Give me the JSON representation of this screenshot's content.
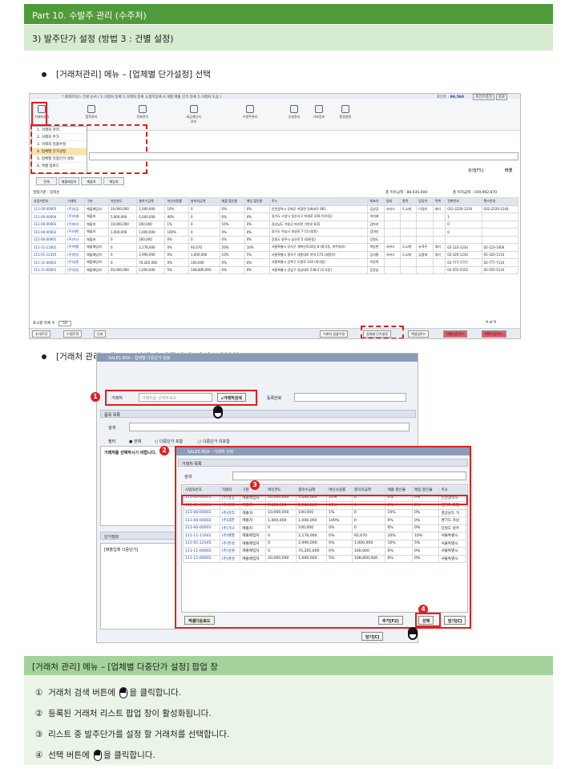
{
  "part_title": "Part 10. 수발주 관리 (수주처)",
  "section_title": "3) 발주단가 설정 (방법 3 : 건별 설정)",
  "bullet1": "[거래처관리] 메뉴 – [업체별 단가설정] 선택",
  "bullet2": "[거래처 관리] 메뉴 – [업체별 다중단가 설정] 팝업창",
  "shot1": {
    "top_text": "* 셀렉즈박스 간편 순서 ( 1.거래처 등록  2.거래처 등록  3.품목등록  4.개별 매출 인코 등록  5.거래처 도움 )",
    "point_label": "포인트 : ",
    "point_value": "99,560",
    "point_btn": "포인트충전",
    "exit_btn": "종료",
    "ribbon": [
      "거래처관리",
      "품목관리",
      "전표관리",
      "세금계산서관리",
      "수발주관리",
      "공생관리",
      "기초정보",
      "환경설정"
    ],
    "menu": [
      "1. 거래처 관리",
      "2. 거래처 추가",
      "3. 거래처 일괄수정",
      "4. 업체별 단가설정",
      "5. 업체별 다중단가 설정",
      "6. 엑셀 업로드"
    ],
    "tabs": [
      "전체",
      "매출매입처",
      "매출처",
      "매입처"
    ],
    "search_btn": "검색[F5]",
    "reset_btn": "리셋",
    "sort_label": "정렬기준 : 입력순",
    "sum1": "총 미수금액 : 88,035,000",
    "sum2": "총 미지급액 : 109,992,870",
    "columns": [
      "사업자번호",
      "거래처",
      "구분",
      "여신한도",
      "총미수금액",
      "여신사용률",
      "총미지급액",
      "매출 할인율",
      "매입 할인율",
      "주소",
      "대표자",
      "업태",
      "종목",
      "담당자",
      "직책",
      "전화번호",
      "팩스번호"
    ],
    "rows": [
      [
        "111-00-00005",
        "(주)성공",
        "매출매입처",
        "10,000,000",
        "1,000,000",
        "10%",
        "0",
        "0%",
        "0%",
        "인천광역시 강화군 하점면 강화대로 961",
        "김성공",
        "서비스",
        "도소매",
        "이경리",
        "대리",
        "032-2220-1234",
        "032-2220-1244"
      ],
      [
        "111-00-00004",
        "(주)미래",
        "매출처",
        "5,000,000",
        "2,000,000",
        "40%",
        "0",
        "0%",
        "0%",
        "경기도 고양시 일산서구 미래로 100 (덕이동)",
        "이미래",
        "",
        "",
        "",
        "",
        "1",
        ""
      ],
      [
        "111-00-00003",
        "(주)마리",
        "매출처",
        "10,000,000",
        "100,000",
        "1%",
        "0",
        "10%",
        "0%",
        "경상남도 거창군 마리면 거한로 835",
        "김마리",
        "",
        "",
        "",
        "",
        "0",
        ""
      ],
      [
        "111-00-00002",
        "(주)대한",
        "매출처",
        "1,000,000",
        "1,000,000",
        "100%",
        "0",
        "0%",
        "0%",
        "경기도 하남시 대성로 7-15 (창동)",
        "김대성",
        "",
        "",
        "",
        "",
        "0",
        ""
      ],
      [
        "111-00-00001",
        "(주)가나",
        "매출처",
        "0",
        "100,000",
        "0%",
        "0",
        "0%",
        "0%",
        "강원도 원주시 남산로 5 (명륜동)",
        "강원도",
        "",
        "",
        "",
        "",
        "",
        ""
      ],
      [
        "111-11-11001",
        "(주)백평",
        "매출매입처",
        "0",
        "2,176,000",
        "0%",
        "92,670",
        "20%",
        "10%",
        "서울특별시 강서구 개화산로24길 8 (화곡동, 마주빌라)",
        "백승현",
        "서비스",
        "도소매",
        "뉴욕주",
        "대리",
        "02-123-1234",
        "02-123-1000"
      ],
      [
        "111-01-12345",
        "(주)한성",
        "매출매입처",
        "0",
        "2,990,000",
        "0%",
        "1,000,000",
        "10%",
        "5%",
        "서울특별시 종로구 세종대로 지하 175 (세종로)",
        "김서울",
        "서비스",
        "도소매",
        "김광래",
        "대리",
        "02-320-1234",
        "02-320-1114"
      ],
      [
        "111-11-00002",
        "(주)성원",
        "매출매입처",
        "0",
        "70,265,000",
        "0%",
        "100,000",
        "0%",
        "0%",
        "서울특별시 강북구 도봉로 124 (미아동)",
        "이강북",
        "",
        "",
        "",
        "",
        "02-777-7777",
        "02-777-7114"
      ],
      [
        "111-11-00001",
        "(주)경성",
        "매출매입처",
        "20,000,000",
        "1,000,000",
        "5%",
        "108,800,000",
        "0%",
        "0%",
        "서울특별시 강남구 강남대로 238-2 (도곡동)",
        "김강남",
        "",
        "",
        "",
        "",
        "02-555-5555",
        "02-555-5114"
      ]
    ],
    "page_size_label": "표시할 목록 수 :",
    "page_size": "50",
    "pager": "9 of 9",
    "bottom_left": [
      "추가[F2]",
      "수정[F3]",
      "인쇄"
    ],
    "bottom_right": [
      "거래처 일괄수정",
      "업체별 단가설정",
      "엑셀업로드",
      "엑셀다운로드",
      "PDF다운로드"
    ]
  },
  "shot2": {
    "title": "SALES BOX - 업체별 다중단가 설정",
    "client_label": "거래처",
    "client_placeholder": "거래처를 선택하세요",
    "client_search_btn": "거래처검색",
    "reg_no_label": "등록번호",
    "item_list_label": "품목 목록",
    "search_label": "검색",
    "filter_label": "필터",
    "filter_opts": [
      "● 전체",
      "○ 다중단가 포함",
      "○ 다중단가 미포함"
    ],
    "hint": "거래처를 선택하시기 바랍니다.",
    "price_info_label": "단가정보",
    "price_col": "[매출업체 다중단가]",
    "close_btn": "닫기[C]"
  },
  "shot3": {
    "title": "SALES BOX - 거래처 선택",
    "list_label": "거래처 목록",
    "search_label": "검색",
    "columns": [
      "사업자번호",
      "거래처",
      "구분",
      "여신한도",
      "총미수금액",
      "여신사용률",
      "총미지급액",
      "매출 할인율",
      "매입 할인율",
      "주소"
    ],
    "rows": [
      [
        "111-00-00005",
        "(주)성공",
        "매출매입처",
        "10,000,000",
        "1,000,000",
        "10%",
        "0",
        "0%",
        "0%",
        "인천광역시"
      ],
      [
        "111-00-00004",
        "(주)미래",
        "매출처",
        "5,000,000",
        "2,000,000",
        "40%",
        "0",
        "0%",
        "0%",
        "경기도 고양"
      ],
      [
        "111-00-00003",
        "(주)마리",
        "매출처",
        "10,000,000",
        "100,000",
        "1%",
        "0",
        "10%",
        "0%",
        "경상남도 거"
      ],
      [
        "111-00-00002",
        "(주)대한",
        "매출처",
        "1,000,000",
        "1,000,000",
        "100%",
        "0",
        "0%",
        "0%",
        "경기도 하남"
      ],
      [
        "111-00-00001",
        "(주)가나",
        "매출처",
        "0",
        "100,000",
        "0%",
        "0",
        "0%",
        "0%",
        "강원도 원주"
      ],
      [
        "111-11-11001",
        "(주)백평",
        "매출매입처",
        "0",
        "2,176,000",
        "0%",
        "92,670",
        "20%",
        "10%",
        "서울특별시"
      ],
      [
        "111-01-12345",
        "(주)한성",
        "매출매입처",
        "0",
        "2,990,000",
        "0%",
        "1,000,000",
        "10%",
        "5%",
        "서울특별시"
      ],
      [
        "111-11-00002",
        "(주)성원",
        "매출매입처",
        "0",
        "70,265,000",
        "0%",
        "100,000",
        "0%",
        "0%",
        "서울특별시"
      ],
      [
        "111-11-00001",
        "(주)경성",
        "매출매입처",
        "20,000,000",
        "1,000,000",
        "5%",
        "108,800,000",
        "0%",
        "0%",
        "서울특별시"
      ]
    ],
    "excel_btn": "엑셀다운로드",
    "add_btn": "추가[F2]",
    "select_btn": "선택",
    "close_btn": "닫기[C]"
  },
  "footer": {
    "title": "[거래처 관리] 메뉴 – [업체별 다중단가 설정] 팝업 창",
    "steps": [
      {
        "num": "①",
        "pre": "거래처 검색 버튼에",
        "post": "을 클릭합니다."
      },
      {
        "num": "②",
        "pre": "등록된 거래처 리스트 팝업 창이 활성화됩니다.",
        "post": ""
      },
      {
        "num": "③",
        "pre": "리스트 중 발주단가를 설정 할 거래처를 선택합니다.",
        "post": ""
      },
      {
        "num": "④",
        "pre": "선택 버튼에",
        "post": "을 클릭합니다."
      }
    ]
  },
  "markers": [
    "1",
    "2",
    "3",
    "4"
  ]
}
